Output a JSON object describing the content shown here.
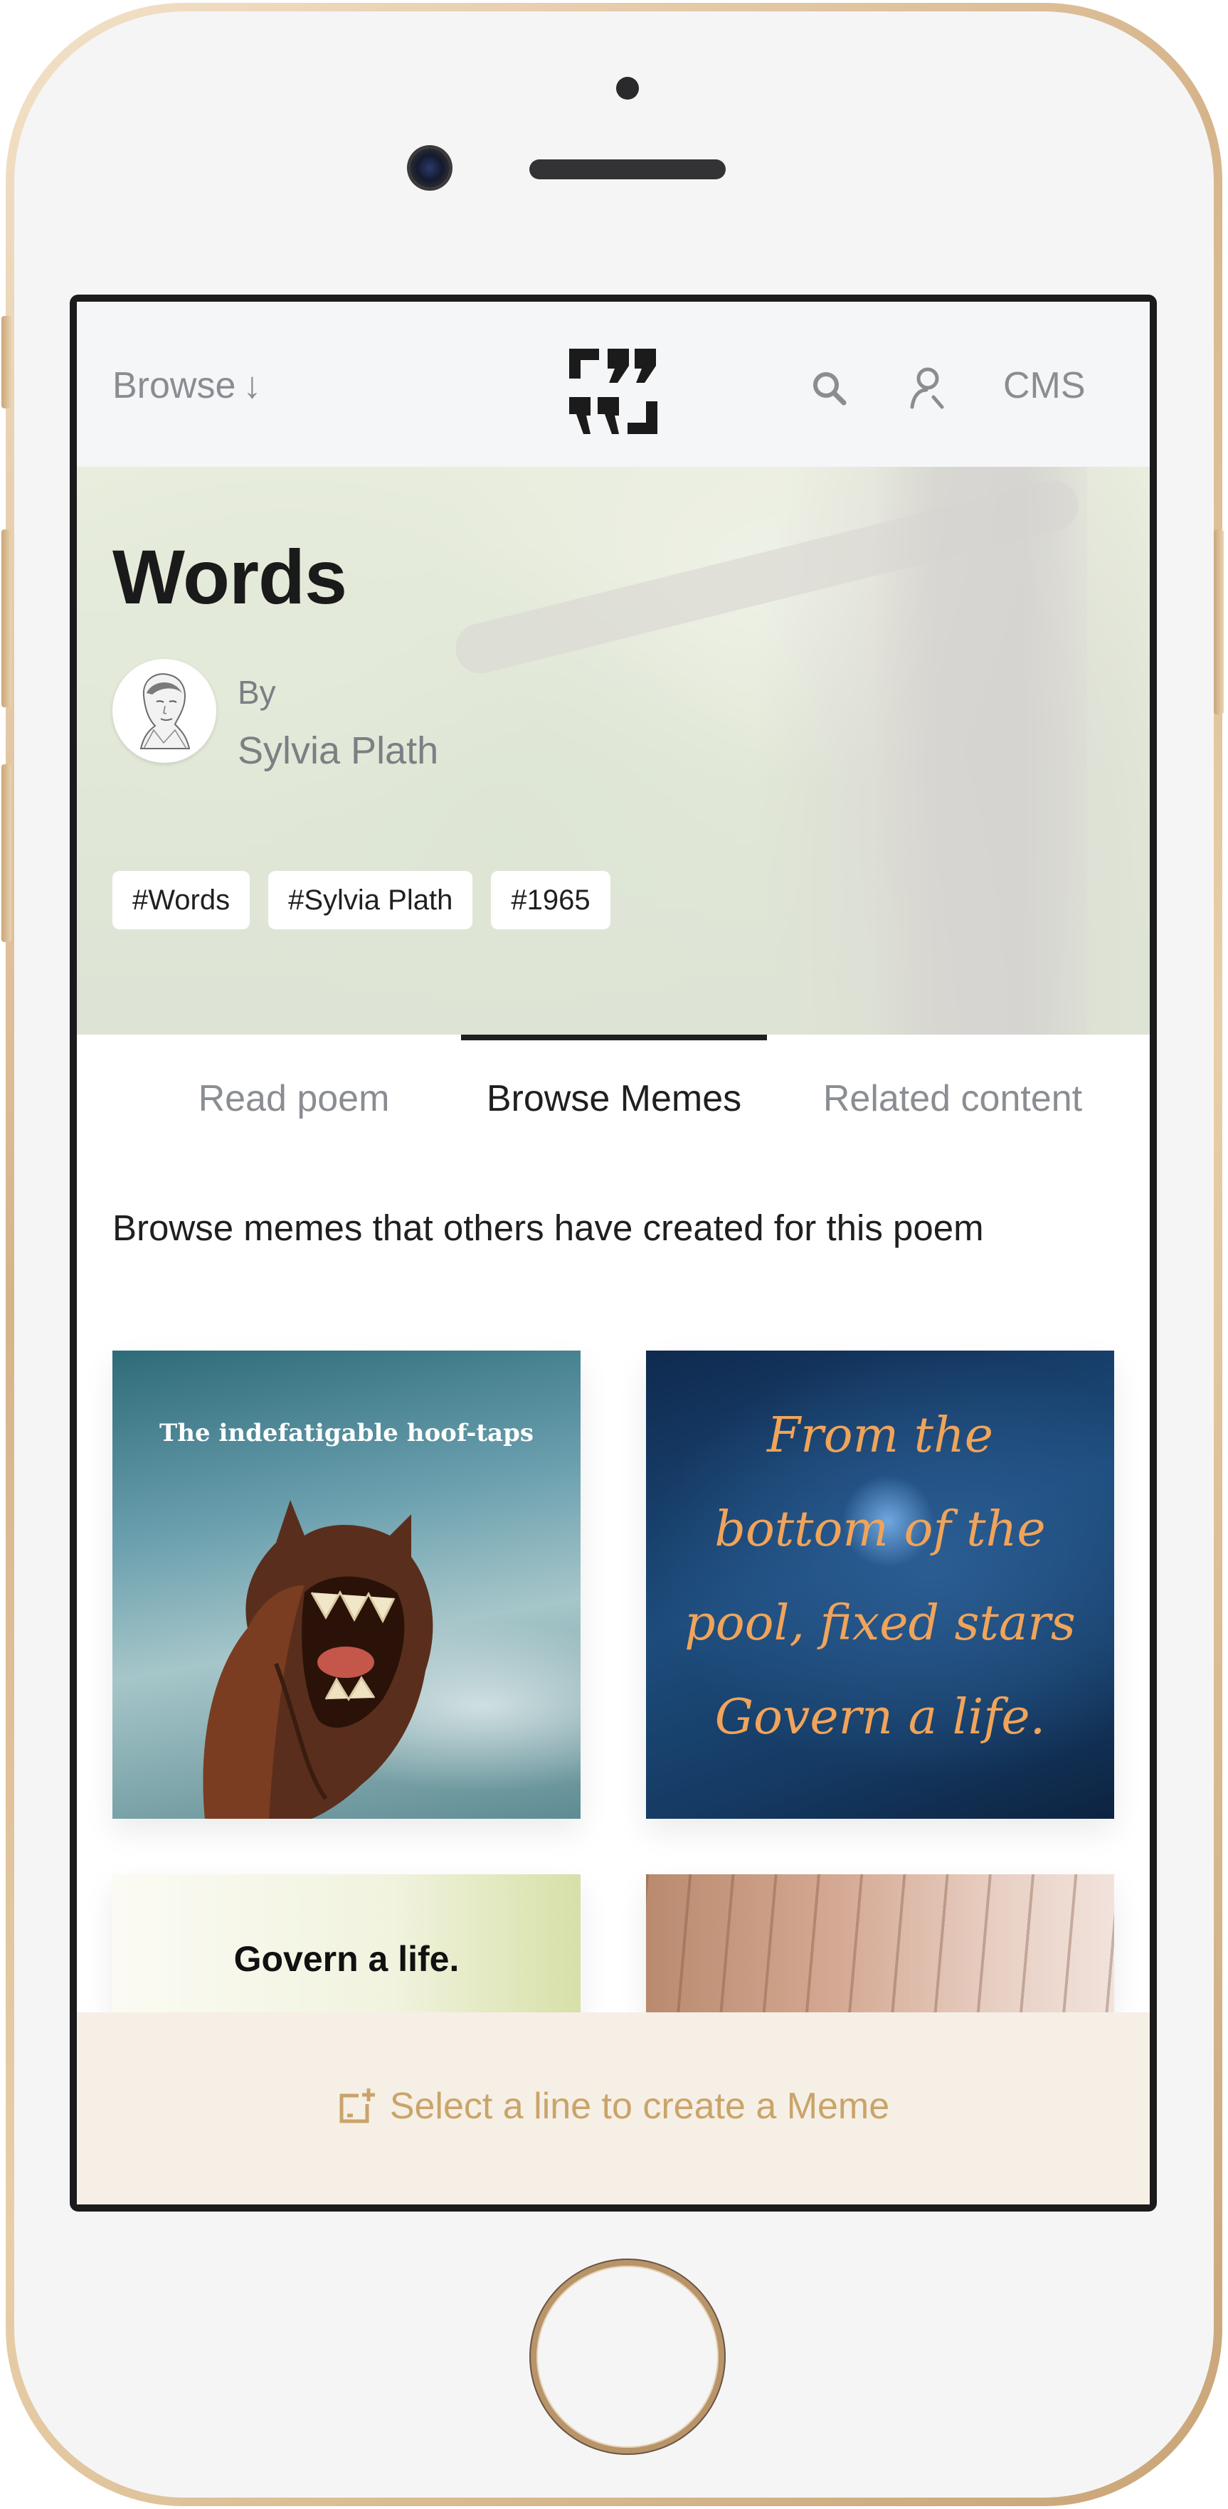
{
  "nav": {
    "browse_label": "Browse",
    "browse_arrow": "↓",
    "cms_label": "CMS"
  },
  "poem": {
    "title": "Words",
    "by_label": "By",
    "author": "Sylvia Plath",
    "tags": [
      "#Words",
      "#Sylvia Plath",
      "#1965"
    ]
  },
  "tabs": {
    "items": [
      "Read poem",
      "Browse Memes",
      "Related content"
    ],
    "active_index": 1
  },
  "browse": {
    "intro": "Browse memes that others have created for this poem"
  },
  "memes": [
    {
      "caption": "The indefatigable hoof-taps"
    },
    {
      "lines": [
        "From the",
        "bottom of the",
        "pool, fixed stars",
        "Govern a life."
      ]
    },
    {
      "caption": "Govern a life."
    },
    {
      "caption": ""
    }
  ],
  "cta": {
    "label": "Select a line to create a Meme"
  },
  "colors": {
    "accent": "#c9a46a",
    "cta_background": "#f6efe5",
    "text_primary": "#1f1f1f",
    "text_muted": "#8a8d91"
  }
}
